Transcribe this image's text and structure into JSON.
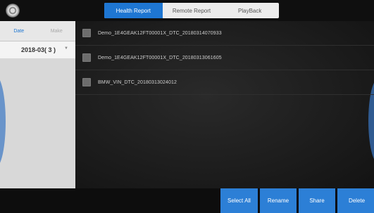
{
  "tabs": [
    "Health Report",
    "Remote Report",
    "PlayBack"
  ],
  "sidebar": {
    "subtabs": [
      "Date",
      "Make"
    ],
    "date_item": "2018-03( 3 )"
  },
  "files": [
    "Demo_1E4GEAK12FT00001X_DTC_20180314070933",
    "Demo_1E4GEAK12FT00001X_DTC_20180313061605",
    "BMW_VIN_DTC_20180313024012"
  ],
  "actions": [
    "Select All",
    "Rename",
    "Share",
    "Delete"
  ],
  "colors": {
    "accent": "#1e76d2",
    "button": "#2c7fd6"
  }
}
